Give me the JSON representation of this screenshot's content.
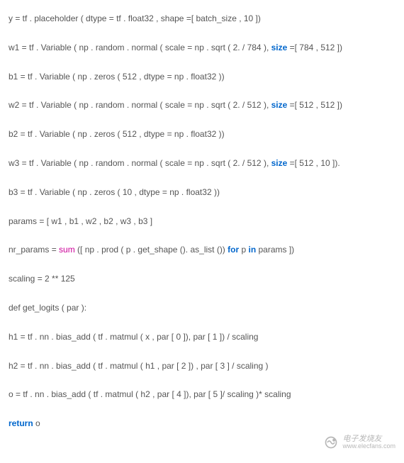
{
  "lines": {
    "l1_a": "y = tf . placeholder ( dtype = tf . float32 , shape =[ batch_size , 10 ])",
    "l2_a": "w1 = tf . Variable ( np . random . normal ( scale = np . sqrt ( 2. / 784 ), ",
    "l2_size": "size",
    "l2_b": " =[ 784 , 512 ])",
    "l3_a": "b1 = tf . Variable ( np . zeros ( 512 , dtype = np . float32 ))",
    "l4_a": "w2 = tf . Variable ( np . random . normal ( scale = np . sqrt ( 2. / 512 ), ",
    "l4_size": "size",
    "l4_b": " =[ 512 , 512 ])",
    "l5_a": "b2 = tf . Variable ( np . zeros ( 512 , dtype = np . float32 ))",
    "l6_a": "w3 = tf . Variable ( np . random . normal ( scale = np . sqrt ( 2. / 512 ), ",
    "l6_size": "size",
    "l6_b": " =[ 512 , 10 ]).",
    "l7_a": "b3 = tf . Variable ( np . zeros ( 10 , dtype = np . float32 ))",
    "l8_a": "params = [ w1 , b1 , w2 , b2 , w3 , b3 ]",
    "l9_a": "nr_params = ",
    "l9_sum": "sum",
    "l9_b": " ([ np . prod ( p . get_shape (). as_list ()) ",
    "l9_for": "for",
    "l9_c": " p ",
    "l9_in": "in",
    "l9_d": " params ])",
    "l10_a": "scaling = 2 ** 125",
    "l11_a": "def get_logits ( par ):",
    "l12_a": "h1 = tf . nn . bias_add ( tf . matmul ( x , par [ 0 ]), par [ 1 ]) / scaling",
    "l13_a": "h2 = tf . nn . bias_add ( tf . matmul ( h1 , par [ 2 ]) , par [ 3 ] / scaling )",
    "l14_a": "o = tf . nn . bias_add ( tf . matmul ( h2 , par [ 4 ]), par [ 5 ]/ scaling )* scaling",
    "l15_return": "return",
    "l15_a": " o"
  },
  "watermark": {
    "top": "电子发烧友",
    "bottom": "www.elecfans.com"
  }
}
